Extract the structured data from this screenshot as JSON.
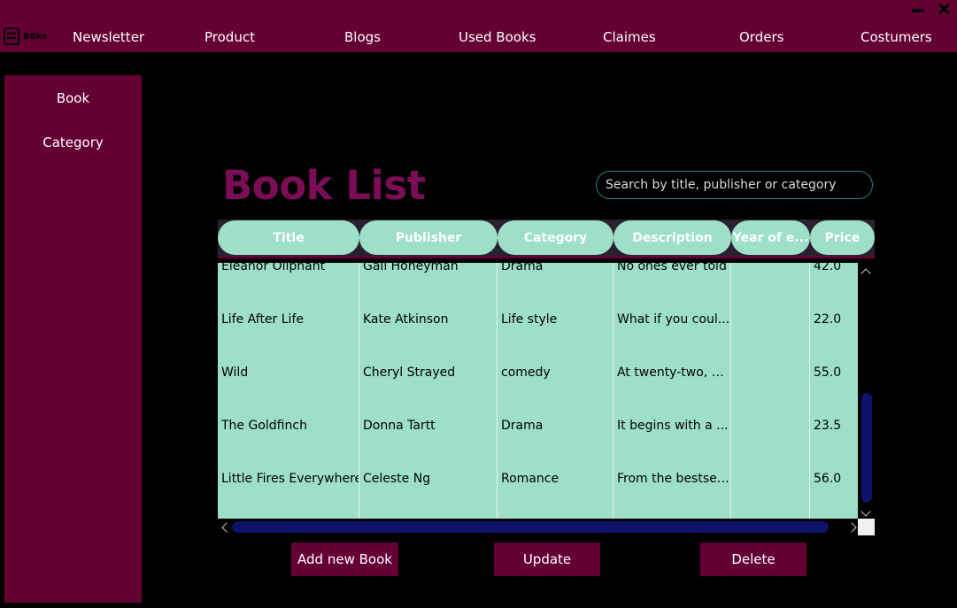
{
  "app": {
    "logo_text": "B8ks"
  },
  "nav": {
    "items": [
      "Newsletter",
      "Product",
      "Blogs",
      "Used Books",
      "Claimes",
      "Orders",
      "Costumers"
    ]
  },
  "window_controls": {
    "minimize_icon": "minimize-icon",
    "close_icon": "close-icon"
  },
  "sidebar": {
    "items": [
      "Book",
      "Category"
    ]
  },
  "main": {
    "title": "Book List",
    "search_placeholder": "Search by title, publisher or category"
  },
  "table": {
    "columns": [
      "Title",
      "Publisher",
      "Category",
      "Description",
      "Year of e...",
      "Price"
    ],
    "rows": [
      [
        "Eleanor Oliphant",
        "Gail Honeyman",
        "Drama",
        "No ones ever told I",
        "",
        "42.0"
      ],
      [
        "Life After Life",
        "Kate Atkinson",
        "Life style",
        "What if you coul...",
        "",
        "22.0"
      ],
      [
        "Wild",
        "Cheryl Strayed",
        "comedy",
        "At twenty-two, C...",
        "",
        "55.0"
      ],
      [
        "The Goldfinch",
        "Donna Tartt",
        "Drama",
        "It begins with a ...",
        "",
        "23.5"
      ],
      [
        "Little Fires Everywhere",
        "Celeste Ng",
        "Romance",
        "From the bestsel...",
        "",
        "56.0"
      ]
    ]
  },
  "actions": {
    "add_label": "Add new Book",
    "update_label": "Update",
    "delete_label": "Delete"
  },
  "colors": {
    "brand": "#650033",
    "title": "#7b0d56",
    "table_bg": "#9ddfc7",
    "scroll_thumb": "#0d136a"
  }
}
